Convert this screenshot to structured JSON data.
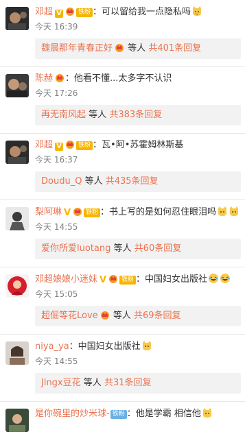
{
  "comments": [
    {
      "user": "邓超",
      "text": "：可以留给我一点隐私吗",
      "time": "今天 16:39",
      "fan_badge": "铁粉",
      "replies": {
        "who": "魏晨那年青春正好",
        "mid": "等人",
        "count": "共401条回复"
      }
    },
    {
      "user": "陈赫",
      "text": "：他看不懂...太多字不认识",
      "time": "今天 17:26",
      "fan_badge": "",
      "replies": {
        "who": "再无南风起",
        "mid": "等人",
        "count": "共383条回复"
      }
    },
    {
      "user": "邓超",
      "text": "：瓦•阿•苏霍姆林斯基",
      "time": "今天 16:37",
      "fan_badge": "铁粉",
      "replies": {
        "who": "Doudu_Q",
        "mid": "等人",
        "count": "共435条回复"
      }
    },
    {
      "user": "梨阿琳",
      "text": "：书上写的是如何忍住眼泪吗",
      "time": "今天 14:55",
      "fan_badge": "铁粉",
      "replies": {
        "who": "爱你所爱luotang",
        "mid": "等人",
        "count": "共60条回复"
      }
    },
    {
      "user": "邓超娘娘小迷妹",
      "text": "：中国妇女出版社",
      "time": "今天 15:05",
      "fan_badge": "铁粉",
      "replies": {
        "who": "超倔等花Love",
        "mid": "等人",
        "count": "共69条回复"
      }
    },
    {
      "user": "niya_ya",
      "text": "：中国妇女出版社",
      "time": "今天 14:55",
      "fan_badge": "",
      "replies": {
        "who": "Jlngx豆花",
        "mid": "等人",
        "count": "共31条回复"
      }
    },
    {
      "user": "是你碗里的炒米球-",
      "text": "：他是学霸 相信他",
      "time": "",
      "fan_badge": "铁粉",
      "replies": null
    }
  ],
  "colors": {
    "name": "#eb7350",
    "badge": "#f7b500",
    "reply_bg": "#f2f2f2",
    "time": "#808080"
  },
  "icons": {
    "verified": "v-badge-icon",
    "crown": "crown-icon",
    "emoji_cat": "cat-emoji-icon",
    "emoji_laugh": "laugh-emoji-icon"
  }
}
